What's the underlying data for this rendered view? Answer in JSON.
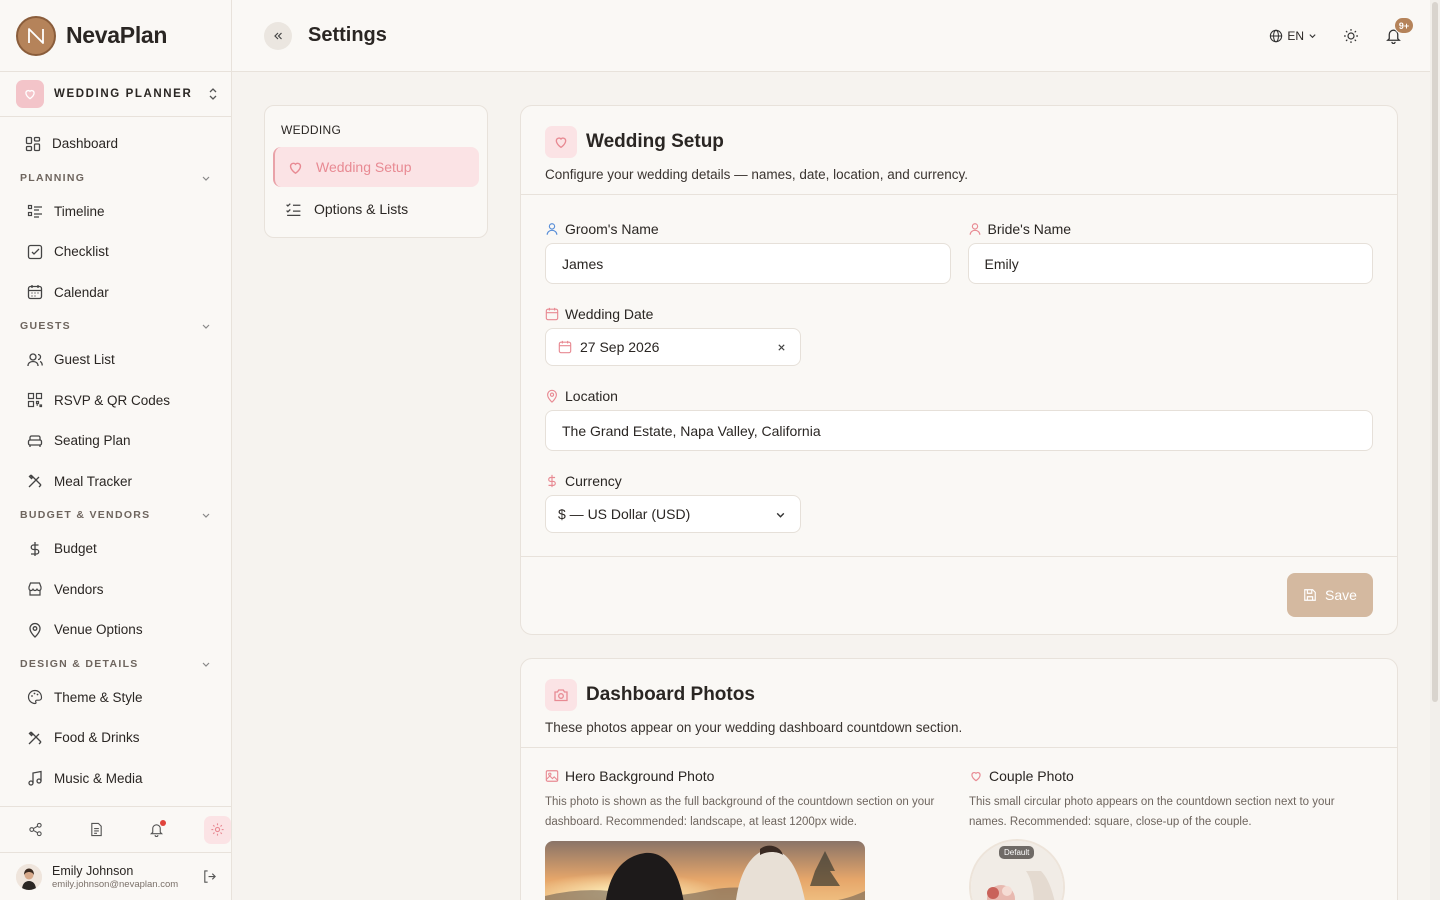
{
  "brand": {
    "name": "NevaPlan"
  },
  "workspace": {
    "label": "WEDDING PLANNER"
  },
  "sidebar": {
    "dashboard": "Dashboard",
    "sections": [
      {
        "title": "PLANNING",
        "items": [
          "Timeline",
          "Checklist",
          "Calendar"
        ]
      },
      {
        "title": "GUESTS",
        "items": [
          "Guest List",
          "RSVP & QR Codes",
          "Seating Plan",
          "Meal Tracker"
        ]
      },
      {
        "title": "BUDGET & VENDORS",
        "items": [
          "Budget",
          "Vendors",
          "Venue Options"
        ]
      },
      {
        "title": "DESIGN & DETAILS",
        "items": [
          "Theme & Style",
          "Food & Drinks",
          "Music & Media"
        ]
      }
    ]
  },
  "user": {
    "name": "Emily Johnson",
    "email": "emily.johnson@nevaplan.com"
  },
  "topbar": {
    "title": "Settings",
    "language": "EN",
    "notification_badge": "9+"
  },
  "settings_nav": {
    "heading": "WEDDING",
    "items": [
      "Wedding Setup",
      "Options & Lists"
    ],
    "active": "Wedding Setup"
  },
  "wedding_setup": {
    "title": "Wedding Setup",
    "description": "Configure your wedding details — names, date, location, and currency.",
    "groom_label": "Groom's Name",
    "groom_value": "James",
    "bride_label": "Bride's Name",
    "bride_value": "Emily",
    "date_label": "Wedding Date",
    "date_value": "27 Sep 2026",
    "location_label": "Location",
    "location_value": "The Grand Estate, Napa Valley, California",
    "currency_label": "Currency",
    "currency_value": "$ — US Dollar (USD)",
    "save_label": "Save"
  },
  "dashboard_photos": {
    "title": "Dashboard Photos",
    "description": "These photos appear on your wedding dashboard countdown section.",
    "hero_label": "Hero Background Photo",
    "hero_desc": "This photo is shown as the full background of the countdown section on your dashboard. Recommended: landscape, at least 1200px wide.",
    "couple_label": "Couple Photo",
    "couple_desc": "This small circular photo appears on the countdown section next to your names. Recommended: square, close-up of the couple.",
    "default_tag": "Default"
  },
  "colors": {
    "accent": "#b5835a",
    "pink": "#e88a93",
    "pink_bg": "#fbe3e5"
  }
}
